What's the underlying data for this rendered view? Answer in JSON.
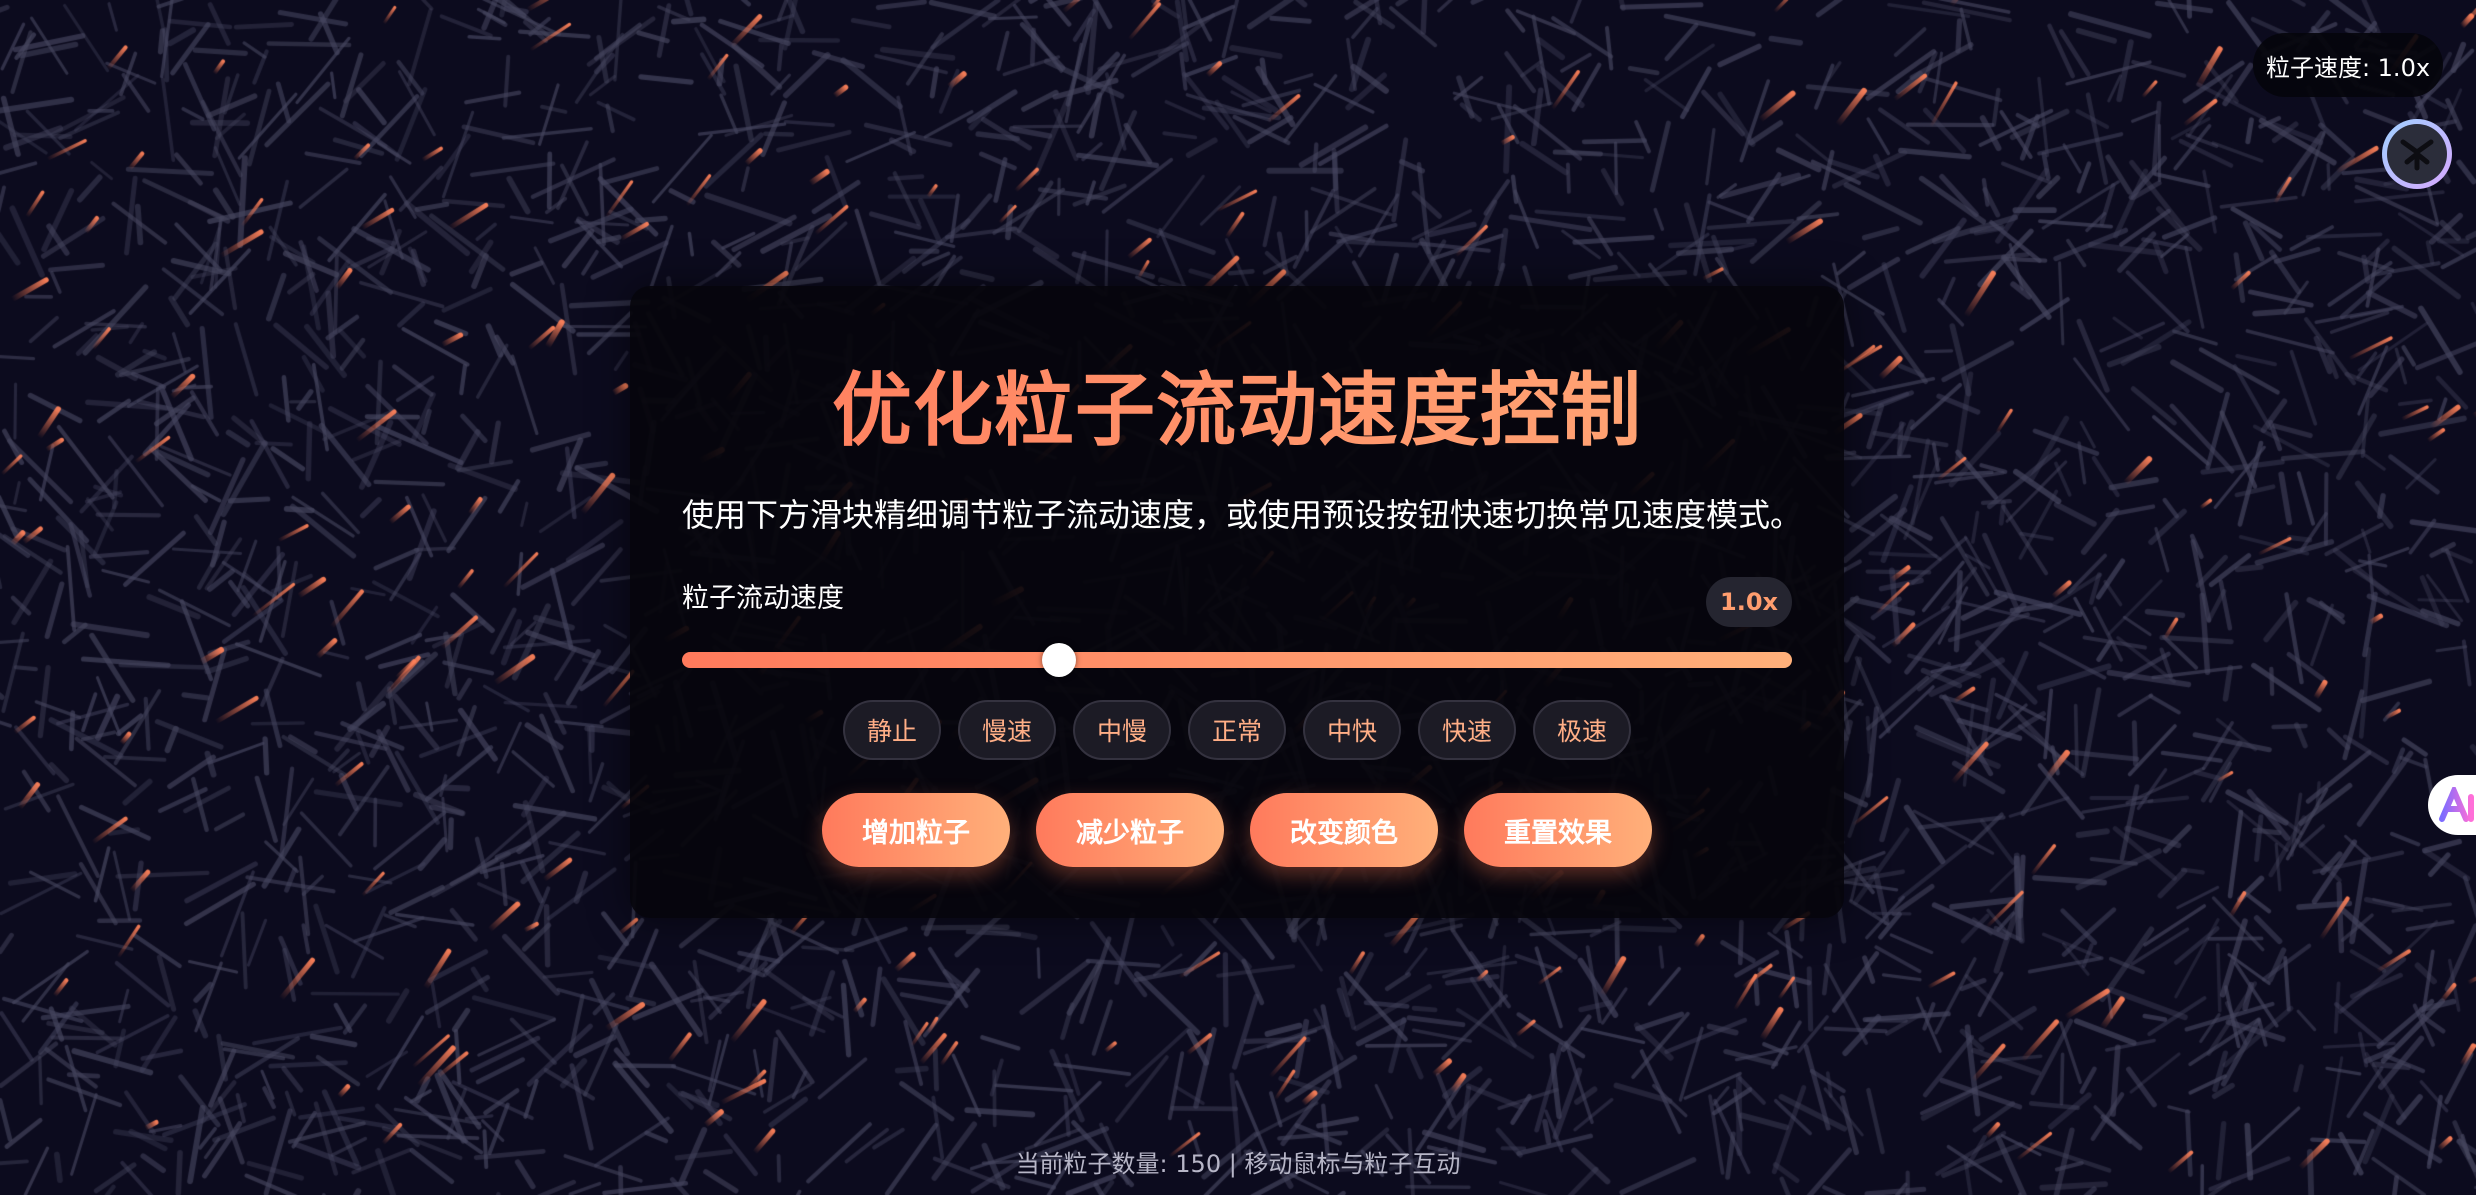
{
  "speed_indicator": "粒子速度: 1.0x",
  "panel": {
    "title": "优化粒子流动速度控制",
    "description": "使用下方滑块精细调节粒子流动速度，或使用预设按钮快速切换常见速度模式。",
    "slider_label": "粒子流动速度",
    "speed_value": "1.0x",
    "slider_fraction": 0.34,
    "presets": [
      "静止",
      "慢速",
      "中慢",
      "正常",
      "中快",
      "快速",
      "极速"
    ],
    "actions": [
      "增加粒子",
      "减少粒子",
      "改变颜色",
      "重置效果"
    ]
  },
  "footer": "当前粒子数量: 150 | 移动鼠标与粒子互动",
  "colors": {
    "background": "#0c0b1e",
    "accent_start": "#ff7a5c",
    "accent_end": "#ffb07a",
    "preset_text": "#ffae86"
  },
  "icons": [
    "corner-logo-icon",
    "ai-assistant-icon"
  ]
}
